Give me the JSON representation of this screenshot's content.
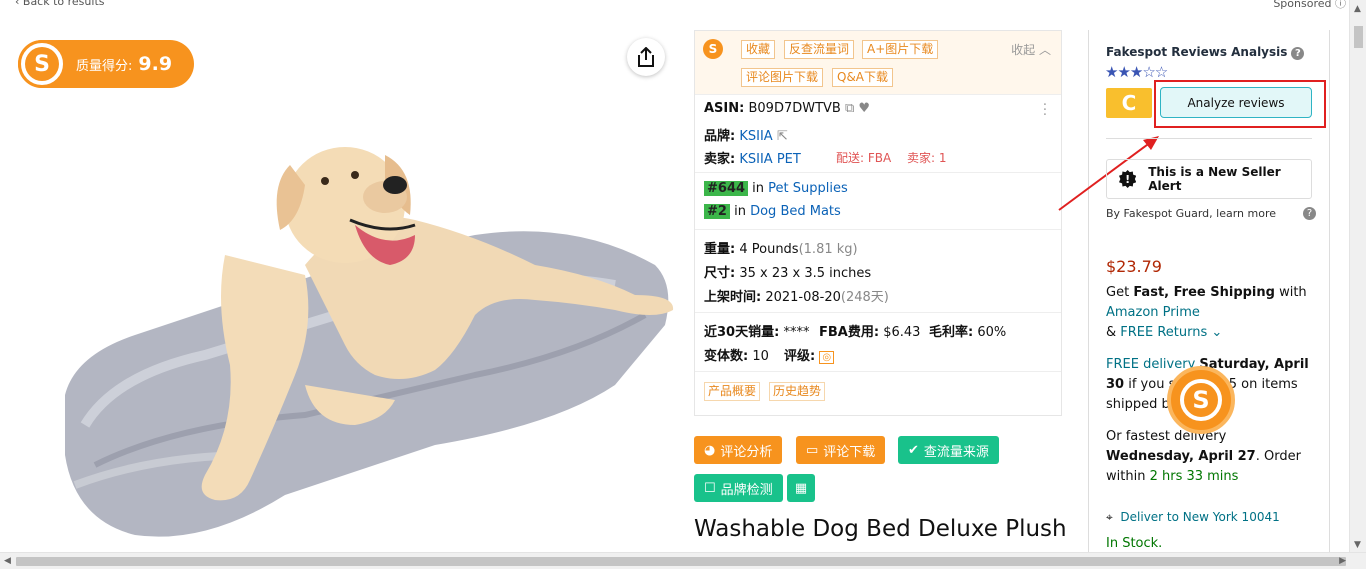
{
  "nav": {
    "back": "‹ Back to results",
    "sponsored": "Sponsored"
  },
  "quality": {
    "label": "质量得分:",
    "value": "9.9",
    "logo_letter": "S"
  },
  "panel": {
    "logo_letter": "S",
    "tags": [
      "收藏",
      "反查流量词",
      "A+图片下载",
      "评论图片下载",
      "Q&A下载"
    ],
    "collapse": "收起",
    "asin_label": "ASIN:",
    "asin": "B09D7DWTVB",
    "brand_label": "品牌:",
    "brand": "KSIIA",
    "seller_label": "卖家:",
    "seller": "KSIIA PET",
    "ship_label": "配送:",
    "ship": "FBA",
    "sellers_label": "卖家:",
    "sellers": "1",
    "ranks": [
      {
        "rank": "#644",
        "in": "in",
        "category": "Pet Supplies"
      },
      {
        "rank": "#2",
        "in": "in",
        "category": "Dog Bed Mats"
      }
    ],
    "weight_label": "重量:",
    "weight": "4 Pounds",
    "weight_kg": "(1.81 kg)",
    "size_label": "尺寸:",
    "size": "35 x 23 x 3.5 inches",
    "listed_label": "上架时间:",
    "listed": "2021-08-20",
    "listed_days": "(248天)",
    "sales_label": "近30天销量:",
    "sales": "****",
    "fba_label": "FBA费用:",
    "fba": "$6.43",
    "margin_label": "毛利率:",
    "margin": "60%",
    "variants_label": "变体数:",
    "variants": "10",
    "rating_label": "评级:",
    "bottom_tags": [
      "产品概要",
      "历史趋势"
    ]
  },
  "actions": {
    "review_analysis": "评论分析",
    "review_download": "评论下载",
    "traffic_source": "查流量来源",
    "brand_check": "品牌检测"
  },
  "product_title": "Washable Dog Bed Deluxe Plush",
  "fakespot": {
    "title": "Fakespot Reviews Analysis",
    "stars": "★★★☆☆",
    "grade": "C",
    "analyze": "Analyze reviews",
    "alert": "This is a New Seller Alert",
    "guard": "By Fakespot Guard, learn more"
  },
  "buybox": {
    "price": "$23.79",
    "get": "Get",
    "fast_free": "Fast, Free Shipping",
    "with": "with",
    "prime": "Amazon Prime",
    "amp": "&",
    "free_returns": "FREE Returns",
    "free_delivery": "FREE delivery",
    "free_delivery_date": "Saturday, April 30",
    "if_you_spend": "if you spend $25 on items shipped by Amazon",
    "fastest": "Or fastest delivery",
    "fastest_date": "Wednesday, April 27",
    "order_within": ". Order within",
    "countdown": "2 hrs 33 mins",
    "deliver_to": "Deliver to New York 10041",
    "in_stock": "In Stock."
  }
}
